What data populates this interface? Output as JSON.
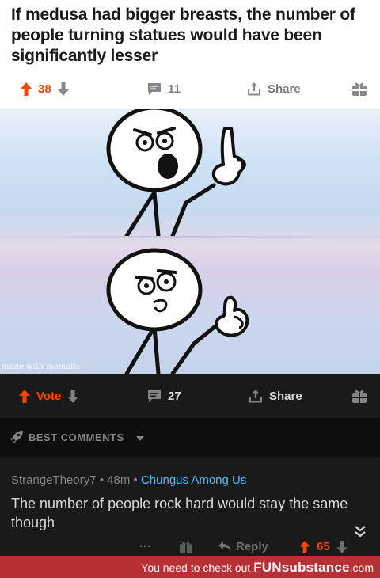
{
  "post": {
    "title": "If medusa had bigger breasts, the number of people turning statues would have been significantly lesser",
    "upvotes": "38",
    "comments": "11",
    "share_label": "Share"
  },
  "meme": {
    "watermark": "made with mematic"
  },
  "embedded_post": {
    "vote_label": "Vote",
    "comments": "27",
    "share_label": "Share"
  },
  "best_comments": {
    "label": "BEST COMMENTS"
  },
  "comment": {
    "author": "StrangeTheory7",
    "age": "48m",
    "subreddit": "Chungus Among Us",
    "text": "The number of people rock hard would stay the same though",
    "ellipsis": "···",
    "reply_label": "Reply",
    "score": "65"
  },
  "footer": {
    "prefix": "You need to check out",
    "brand": "FUNsubstance",
    "suffix": ".com"
  },
  "colors": {
    "upvote": "#ff4500",
    "subreddit_link": "#4fbcff",
    "footer_bg": "#b73035"
  }
}
